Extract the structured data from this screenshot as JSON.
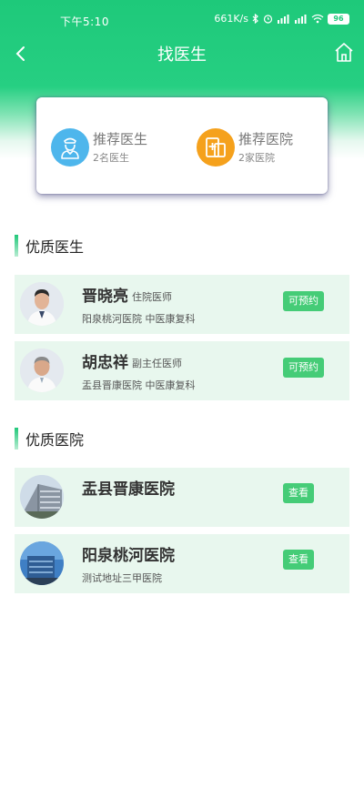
{
  "status": {
    "time": "下午5:10",
    "speed": "661K/s",
    "battery": "96"
  },
  "nav": {
    "title": "找医生"
  },
  "summary": [
    {
      "label": "推荐医生",
      "count": "2名医生",
      "color": "#4eb6ec",
      "icon": "doctor-icon"
    },
    {
      "label": "推荐医院",
      "count": "2家医院",
      "color": "#f5a11c",
      "icon": "hospital-icon"
    }
  ],
  "doctors_section": {
    "title": "优质医生"
  },
  "doctors": [
    {
      "name": "晋晓亮",
      "title": "住院医师",
      "hospital": "阳泉桃河医院 中医康复科",
      "action": "可预约"
    },
    {
      "name": "胡忠祥",
      "title": "副主任医师",
      "hospital": "盂县晋康医院 中医康复科",
      "action": "可预约"
    }
  ],
  "hospitals_section": {
    "title": "优质医院"
  },
  "hospitals": [
    {
      "name": "盂县晋康医院",
      "address": "",
      "action": "查看"
    },
    {
      "name": "阳泉桃河医院",
      "address": "测试地址三甲医院",
      "action": "查看"
    }
  ],
  "colors": {
    "accent": "#1ec97a",
    "row_bg": "#e8f7ee",
    "button": "#45cc77"
  }
}
